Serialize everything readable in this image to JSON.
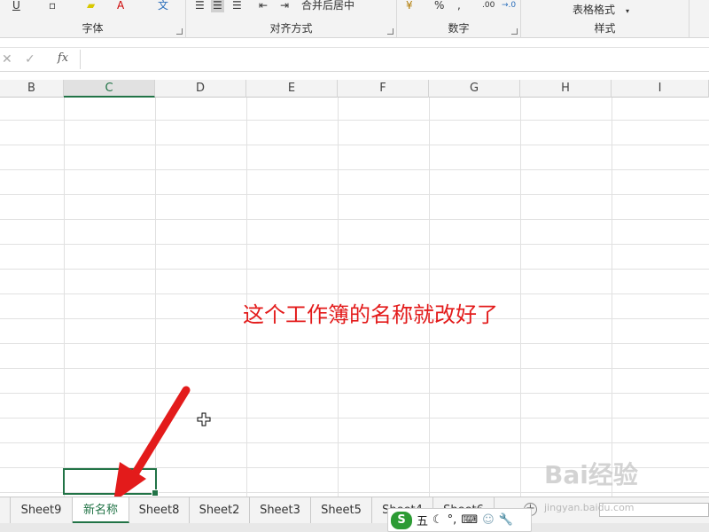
{
  "ribbon": {
    "groups": {
      "font": "字体",
      "align": "对齐方式",
      "number": "数字",
      "styles": "样式"
    },
    "merge_center": "合并后居中",
    "table_format": "表格格式",
    "percent": "%",
    "comma": ","
  },
  "formula_bar": {
    "cancel": "✕",
    "enter": "✓",
    "fx": "fx"
  },
  "columns": [
    "B",
    "C",
    "D",
    "E",
    "F",
    "G",
    "H",
    "I"
  ],
  "selected_column": "C",
  "annotation": "这个工作簿的名称就改好了",
  "sheet_tabs": [
    "Sheet9",
    "新名称",
    "Sheet8",
    "Sheet2",
    "Sheet3",
    "Sheet5",
    "Sheet4",
    "Sheet6"
  ],
  "active_tab": "新名称",
  "ime": {
    "logo": "S",
    "mode": "五"
  },
  "watermark": {
    "brand": "Bai经验",
    "url": "jingyan.baidu.com"
  },
  "colors": {
    "accent": "#217346",
    "annotation": "#e31b1b",
    "arrow": "#e31b1b"
  }
}
